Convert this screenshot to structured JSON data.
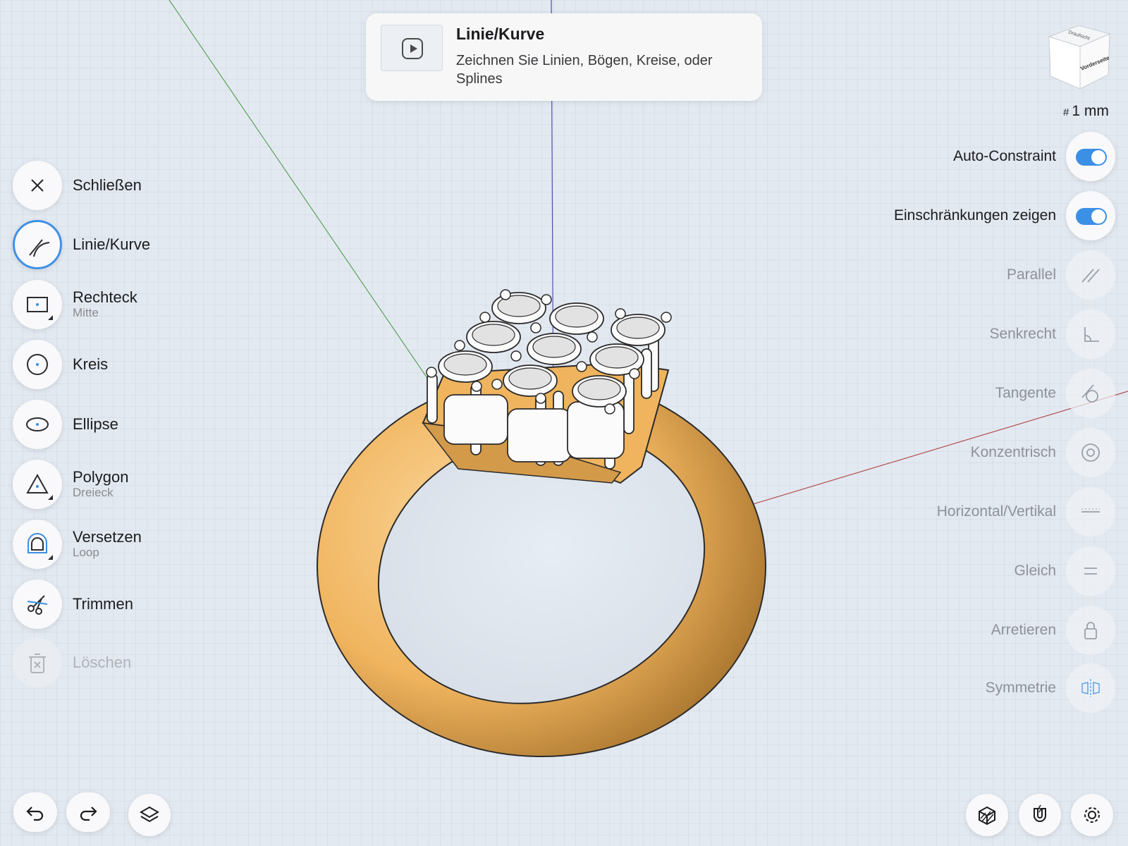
{
  "tooltip": {
    "title": "Linie/Kurve",
    "description": "Zeichnen Sie Linien, Bögen, Kreise, oder Splines",
    "play_icon": "play-icon"
  },
  "tools": [
    {
      "label": "Schließen",
      "sublabel": "",
      "icon": "close-icon",
      "active": false,
      "disabled": false
    },
    {
      "label": "Linie/Kurve",
      "sublabel": "",
      "icon": "line-curve-icon",
      "active": true,
      "disabled": false
    },
    {
      "label": "Rechteck",
      "sublabel": "Mitte",
      "icon": "rectangle-icon",
      "active": false,
      "disabled": false
    },
    {
      "label": "Kreis",
      "sublabel": "",
      "icon": "circle-icon",
      "active": false,
      "disabled": false
    },
    {
      "label": "Ellipse",
      "sublabel": "",
      "icon": "ellipse-icon",
      "active": false,
      "disabled": false
    },
    {
      "label": "Polygon",
      "sublabel": "Dreieck",
      "icon": "polygon-icon",
      "active": false,
      "disabled": false
    },
    {
      "label": "Versetzen",
      "sublabel": "Loop",
      "icon": "offset-icon",
      "active": false,
      "disabled": false
    },
    {
      "label": "Trimmen",
      "sublabel": "",
      "icon": "trim-icon",
      "active": false,
      "disabled": false
    },
    {
      "label": "Löschen",
      "sublabel": "",
      "icon": "trash-icon",
      "active": false,
      "disabled": true
    }
  ],
  "view": {
    "cube_face_label": "Vorderseite",
    "cube_top_label": "Draufsicht",
    "grid_unit": "1 mm",
    "grid_hash": "#"
  },
  "settings": [
    {
      "label": "Auto-Constraint",
      "type": "toggle",
      "on": true
    },
    {
      "label": "Einschränkungen zeigen",
      "type": "toggle",
      "on": true
    }
  ],
  "constraints": [
    {
      "label": "Parallel",
      "icon": "parallel-icon"
    },
    {
      "label": "Senkrecht",
      "icon": "perpendicular-icon"
    },
    {
      "label": "Tangente",
      "icon": "tangent-icon"
    },
    {
      "label": "Konzentrisch",
      "icon": "concentric-icon"
    },
    {
      "label": "Horizontal/Vertikal",
      "icon": "horizontal-vertical-icon"
    },
    {
      "label": "Gleich",
      "icon": "equal-icon"
    },
    {
      "label": "Arretieren",
      "icon": "lock-icon"
    },
    {
      "label": "Symmetrie",
      "icon": "symmetry-icon"
    }
  ],
  "bottom_bar": {
    "left": [
      "undo-icon",
      "redo-icon",
      "layers-icon"
    ],
    "right": [
      "section-view-icon",
      "snap-magnet-icon",
      "settings-gear-icon"
    ]
  },
  "colors": {
    "accent": "#3b8fe5",
    "ring_gold": "#f0b45e",
    "background": "#e3e9f1",
    "axis_x": "#b05050",
    "axis_y": "#4a9a4a",
    "axis_z": "#5050b0"
  }
}
